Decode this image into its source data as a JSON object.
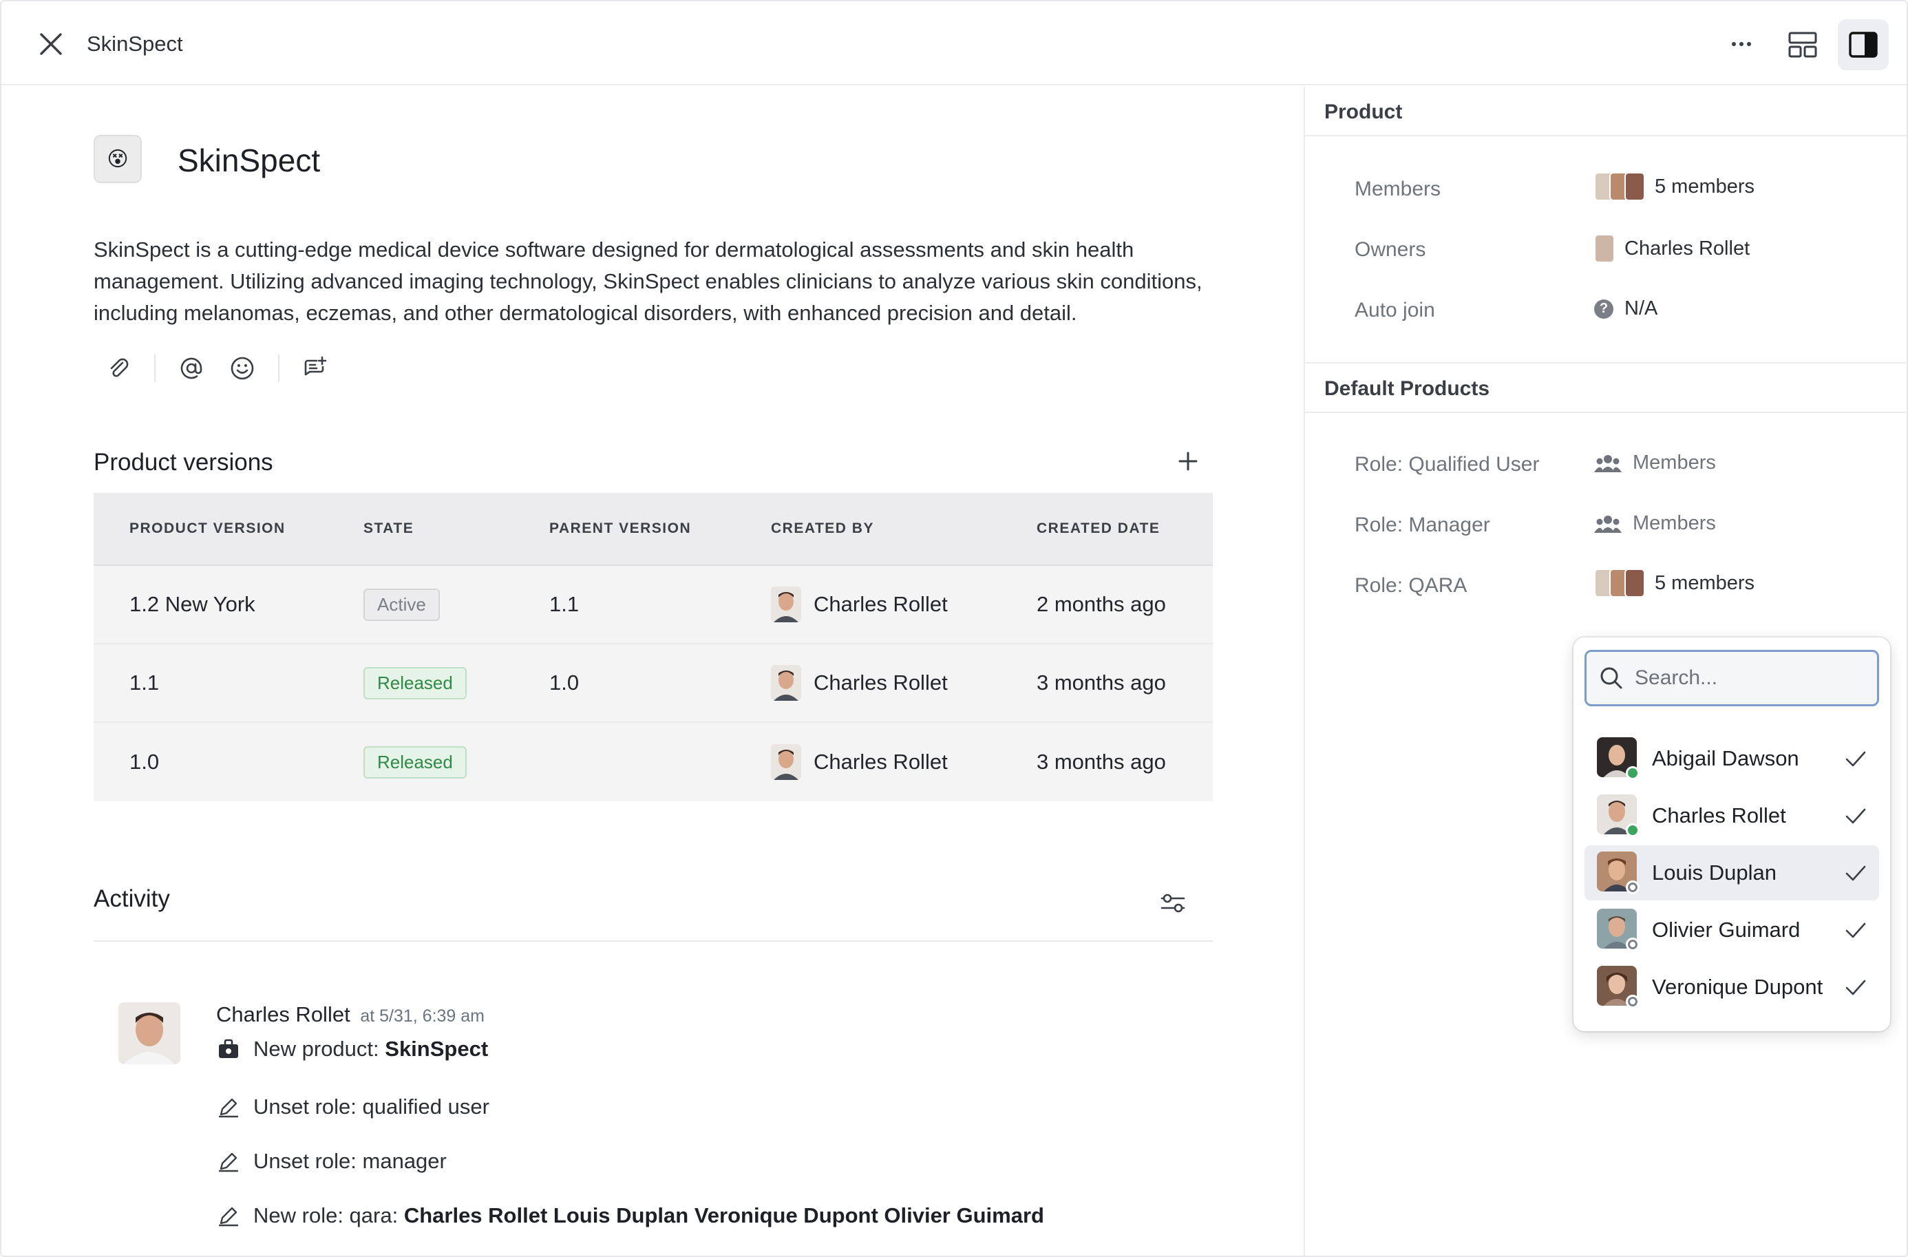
{
  "app": {
    "title": "SkinSpect"
  },
  "product": {
    "name": "SkinSpect",
    "icon": "😵",
    "description": "SkinSpect is a cutting-edge medical device software designed for dermatological assessments and skin health management. Utilizing advanced imaging technology, SkinSpect enables clinicians to analyze various skin conditions, including melanomas, eczemas, and other dermatological disorders, with enhanced precision and detail."
  },
  "versions": {
    "title": "Product versions",
    "columns": [
      "PRODUCT VERSION",
      "STATE",
      "PARENT VERSION",
      "CREATED BY",
      "CREATED DATE"
    ],
    "rows": [
      {
        "version": "1.2 New York",
        "state": "Active",
        "parent": "1.1",
        "created_by": "Charles Rollet",
        "created_date": "2 months ago"
      },
      {
        "version": "1.1",
        "state": "Released",
        "parent": "1.0",
        "created_by": "Charles Rollet",
        "created_date": "3 months ago"
      },
      {
        "version": "1.0",
        "state": "Released",
        "parent": "",
        "created_by": "Charles Rollet",
        "created_date": "3 months ago"
      }
    ]
  },
  "activity": {
    "title": "Activity",
    "author": "Charles Rollet",
    "time": "at 5/31, 6:39 am",
    "new_product_prefix": "New product: ",
    "new_product_name": "SkinSpect",
    "line1": "Unset role: qualified user",
    "line2": "Unset role: manager",
    "line3_prefix": "New role: qara: ",
    "line3_names": "Charles Rollet Louis Duplan Veronique Dupont Olivier Guimard"
  },
  "side": {
    "product_header": "Product",
    "members_label": "Members",
    "members_value": "5 members",
    "owners_label": "Owners",
    "owners_value": "Charles Rollet",
    "autojoin_label": "Auto join",
    "autojoin_value": "N/A",
    "defaults_header": "Default Products",
    "role1_label": "Role: Qualified User",
    "role1_value": "Members",
    "role2_label": "Role: Manager",
    "role2_value": "Members",
    "role3_label": "Role: QARA",
    "role3_value": "5 members"
  },
  "dropdown": {
    "placeholder": "Search...",
    "items": [
      {
        "name": "Abigail Dawson",
        "status": "online",
        "checked": true
      },
      {
        "name": "Charles Rollet",
        "status": "online",
        "checked": true
      },
      {
        "name": "Louis Duplan",
        "status": "offline",
        "checked": true
      },
      {
        "name": "Olivier Guimard",
        "status": "offline",
        "checked": true
      },
      {
        "name": "Veronique Dupont",
        "status": "offline",
        "checked": true
      }
    ]
  },
  "colors": {
    "accent": "#7d9ccb",
    "released": "#2f8a45",
    "online": "#3aa55c"
  }
}
